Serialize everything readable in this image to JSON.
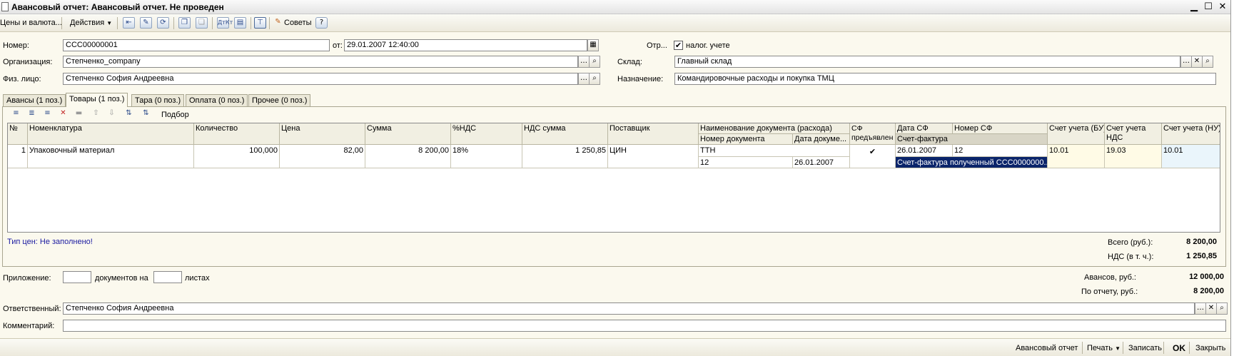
{
  "window": {
    "title": "Авансовый отчет: Авансовый отчет. Не проведен"
  },
  "toolbar": {
    "prices_menu": "Цены и валюта...",
    "actions_menu": "Действия",
    "tips_label": "Советы",
    "help_label": "?"
  },
  "header": {
    "number_label": "Номер:",
    "number_value": "ССС00000001",
    "date_label": "от:",
    "date_value": "29.01.2007 12:40:00",
    "reflect_label": "Отр...",
    "tax_label": "налог. учете",
    "org_label": "Организация:",
    "org_value": "Степченко_company",
    "warehouse_label": "Склад:",
    "warehouse_value": "Главный склад",
    "person_label": "Физ. лицо:",
    "person_value": "Степченко София Андреевна",
    "purpose_label": "Назначение:",
    "purpose_value": "Командировочные расходы и покупка ТМЦ"
  },
  "tabs": [
    {
      "label": "Авансы (1 поз.)"
    },
    {
      "label": "Товары (1 поз.)"
    },
    {
      "label": "Тара (0 поз.)"
    },
    {
      "label": "Оплата (0 поз.)"
    },
    {
      "label": "Прочее (0 поз.)"
    }
  ],
  "grid_toolbar": {
    "pick_label": "Подбор"
  },
  "table": {
    "headers": {
      "no": "№",
      "item": "Номенклатура",
      "qty": "Количество",
      "price": "Цена",
      "sum": "Сумма",
      "vat_pct": "%НДС",
      "vat_sum": "НДС сумма",
      "supplier": "Поставщик",
      "doc_name": "Наименование документа (расхода)",
      "doc_num": "Номер документа",
      "doc_date": "Дата докуме...",
      "invoice_presented": "СФ предъявлен",
      "invoice_date": "Дата СФ",
      "invoice_num": "Номер СФ",
      "invoice": "Счет-фактура",
      "acc_bu": "Счет учета (БУ)",
      "acc_vat": "Счет учета НДС",
      "acc_nu": "Счет учета (НУ)"
    },
    "row": {
      "no": "1",
      "item": "Упаковочный материал",
      "qty": "100,000",
      "price": "82,00",
      "sum": "8 200,00",
      "vat_pct": "18%",
      "vat_sum": "1 250,85",
      "supplier": "ЦИН",
      "doc_name": "ТТН",
      "doc_num": "12",
      "doc_date": "26.01.2007",
      "invoice_presented": "✔",
      "invoice_date": "26.01.2007",
      "invoice_num": "12",
      "invoice": "Счет-фактура полученный ССС0000000...",
      "acc_bu": "10.01",
      "acc_vat": "19.03",
      "acc_nu": "10.01"
    }
  },
  "price_type_note": "Тип цен: Не заполнено!",
  "totals": {
    "total_label": "Всего (руб.):",
    "total_value": "8 200,00",
    "vat_label": "НДС (в т. ч.):",
    "vat_value": "1 250,85"
  },
  "attachment": {
    "label": "Приложение:",
    "docs_label": "документов на",
    "sheets_label": "листах"
  },
  "advances": {
    "advances_label": "Авансов, руб.:",
    "advances_value": "12 000,00",
    "report_label": "По отчету, руб.:",
    "report_value": "8 200,00"
  },
  "footer": {
    "responsible_label": "Ответственный:",
    "responsible_value": "Степченко София Андреевна",
    "comment_label": "Комментарий:",
    "comment_value": ""
  },
  "bottom_bar": {
    "report_btn": "Авансовый отчет",
    "print_btn": "Печать",
    "save_btn": "Записать",
    "ok_btn": "OK",
    "close_btn": "Закрыть"
  }
}
